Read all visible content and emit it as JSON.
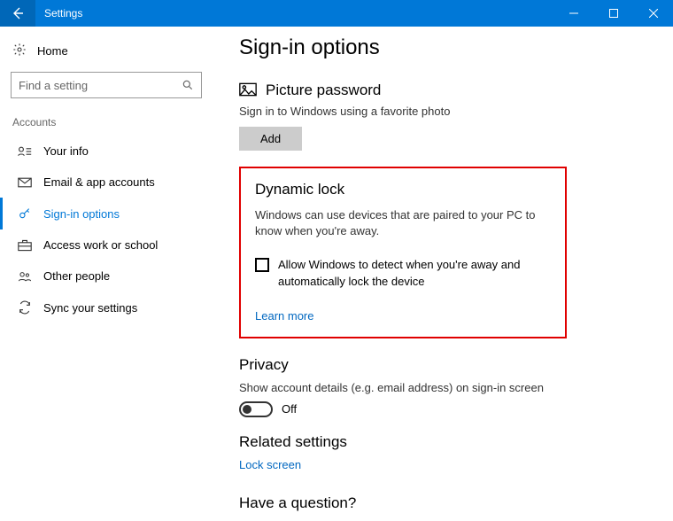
{
  "titlebar": {
    "title": "Settings"
  },
  "sidebar": {
    "home": "Home",
    "search_placeholder": "Find a setting",
    "category": "Accounts",
    "items": [
      {
        "label": "Your info"
      },
      {
        "label": "Email & app accounts"
      },
      {
        "label": "Sign-in options"
      },
      {
        "label": "Access work or school"
      },
      {
        "label": "Other people"
      },
      {
        "label": "Sync your settings"
      }
    ]
  },
  "content": {
    "page_title": "Sign-in options",
    "picture_password": {
      "heading": "Picture password",
      "desc": "Sign in to Windows using a favorite photo",
      "add": "Add"
    },
    "dynamic_lock": {
      "heading": "Dynamic lock",
      "desc": "Windows can use devices that are paired to your PC to know when you're away.",
      "checkbox_label": "Allow Windows to detect when you're away and automatically lock the device",
      "learn_more": "Learn more"
    },
    "privacy": {
      "heading": "Privacy",
      "desc": "Show account details (e.g. email address) on sign-in screen",
      "toggle_state": "Off"
    },
    "related": {
      "heading": "Related settings",
      "link": "Lock screen"
    },
    "question": {
      "heading": "Have a question?"
    }
  }
}
